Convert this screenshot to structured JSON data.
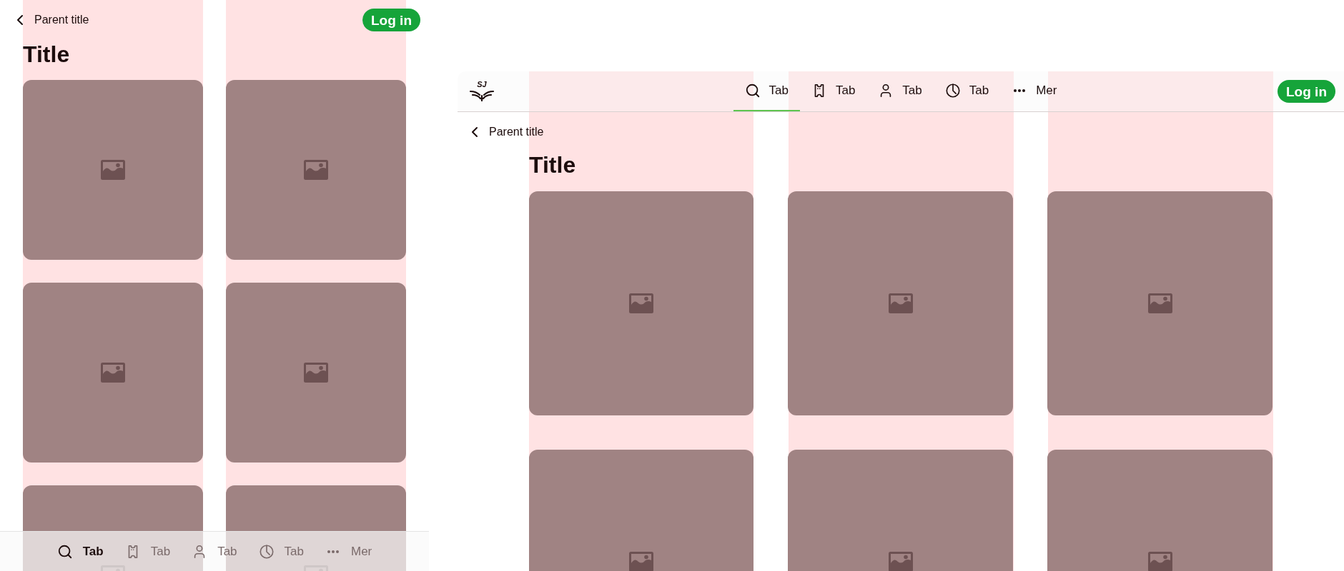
{
  "mobile": {
    "back_label": "Parent title",
    "login": "Log in",
    "title": "Title",
    "tabs": [
      {
        "label": "Tab",
        "selected": true
      },
      {
        "label": "Tab",
        "selected": false
      },
      {
        "label": "Tab",
        "selected": false
      },
      {
        "label": "Tab",
        "selected": false
      },
      {
        "label": "Mer",
        "selected": false
      }
    ]
  },
  "desktop": {
    "logo": "SJ",
    "login": "Log in",
    "back_label": "Parent title",
    "title": "Title",
    "tabs": [
      {
        "label": "Tab",
        "selected": true
      },
      {
        "label": "Tab",
        "selected": false
      },
      {
        "label": "Tab",
        "selected": false
      },
      {
        "label": "Tab",
        "selected": false
      },
      {
        "label": "Mer",
        "selected": false
      }
    ]
  }
}
